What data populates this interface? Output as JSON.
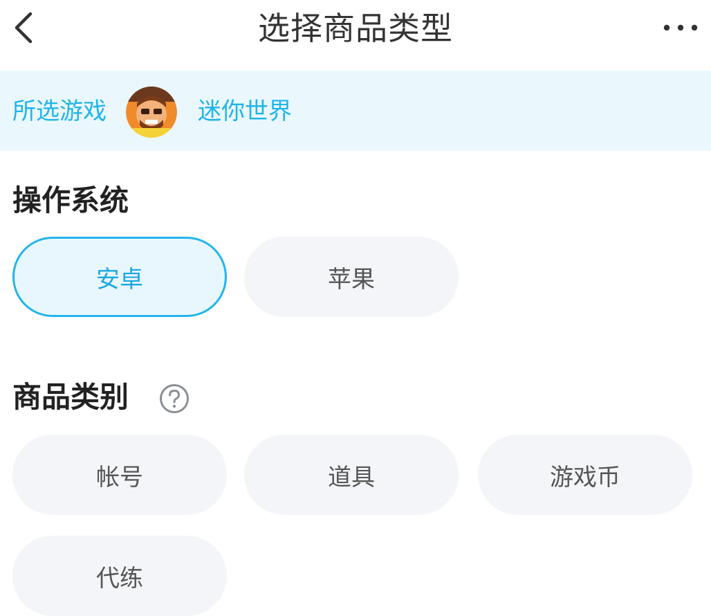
{
  "header": {
    "title": "选择商品类型",
    "back_icon": "chevron-left-icon",
    "more_icon": "more-horizontal-icon"
  },
  "game_bar": {
    "label": "所选游戏",
    "game_name": "迷你世界",
    "avatar_icon": "game-avatar"
  },
  "os_section": {
    "title": "操作系统",
    "options": [
      {
        "label": "安卓",
        "selected": true
      },
      {
        "label": "苹果",
        "selected": false
      }
    ]
  },
  "category_section": {
    "title": "商品类别",
    "help_icon": "question-circle-icon",
    "options": [
      {
        "label": "帐号"
      },
      {
        "label": "道具"
      },
      {
        "label": "游戏币"
      },
      {
        "label": "代练"
      }
    ]
  },
  "colors": {
    "accent": "#20b4ea",
    "game_bar_bg": "#eaf8fd",
    "chip_bg": "#f3f5f8",
    "selected_chip_bg": "#e8f7fd"
  }
}
